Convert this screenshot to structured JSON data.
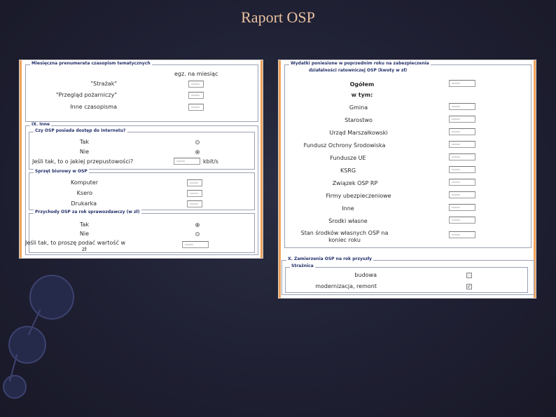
{
  "slide": {
    "title": "Raport OSP"
  },
  "left_panel": {
    "subscriptions": {
      "header": "Miesięczna prenumerata czasopism tematycznych",
      "column_header": "egz. na miesiąc",
      "rows": [
        {
          "label": "\"Strażak\""
        },
        {
          "label": "\"Przegląd pożarniczy\""
        },
        {
          "label": "Inne czasopisma"
        }
      ]
    },
    "other": {
      "header": "IX. Inne",
      "internet": {
        "legend": "Czy OSP posiada dostęp do Internetu?",
        "options": [
          {
            "label": "Tak",
            "selected": false
          },
          {
            "label": "Nie",
            "selected": true
          }
        ],
        "bandwidth_label": "Jeśli tak, to o jakiej przepustowości?",
        "bandwidth_unit": "kbit/s"
      },
      "office": {
        "legend": "Sprzęt biurowy w OSP",
        "items": [
          {
            "label": "Komputer"
          },
          {
            "label": "Ksero"
          },
          {
            "label": "Drukarka"
          }
        ]
      },
      "income": {
        "legend": "Przychody OSP za rok sprawozdawczy (w zł)",
        "options": [
          {
            "label": "Tak",
            "selected": true
          },
          {
            "label": "Nie",
            "selected": false
          }
        ],
        "amount_label_line1": "Jeśli tak, to proszę podać wartość w",
        "amount_label_line2": "zł"
      }
    }
  },
  "right_panel": {
    "expenses": {
      "header_line1": "Wydatki poniesione w poprzednim roku na zabezpieczenia",
      "header_line2": "działalności ratowniczej OSP (kwoty w zł)",
      "total_label": "Ogółem",
      "subtotal_label": "w tym:",
      "rows": [
        {
          "label": "Gmina"
        },
        {
          "label": "Starostwo"
        },
        {
          "label": "Urząd Marszałkowski"
        },
        {
          "label": "Fundusz Ochrony Środowiska"
        },
        {
          "label": "Fundusze UE"
        },
        {
          "label": "KSRG"
        },
        {
          "label": "Związek OSP RP"
        },
        {
          "label": "Firmy ubezpieczeniowe"
        },
        {
          "label": "Inne"
        },
        {
          "label": "Środki własne"
        }
      ],
      "balance_line1": "Stan środków własnych OSP na",
      "balance_line2": "koniec roku"
    },
    "plans": {
      "header": "X. Zamierzenia OSP na rok przyszły",
      "legend": "Strażnica",
      "items": [
        {
          "label": "budowa",
          "checked": false
        },
        {
          "label": "modernizacja, remont",
          "checked": true
        }
      ]
    }
  }
}
